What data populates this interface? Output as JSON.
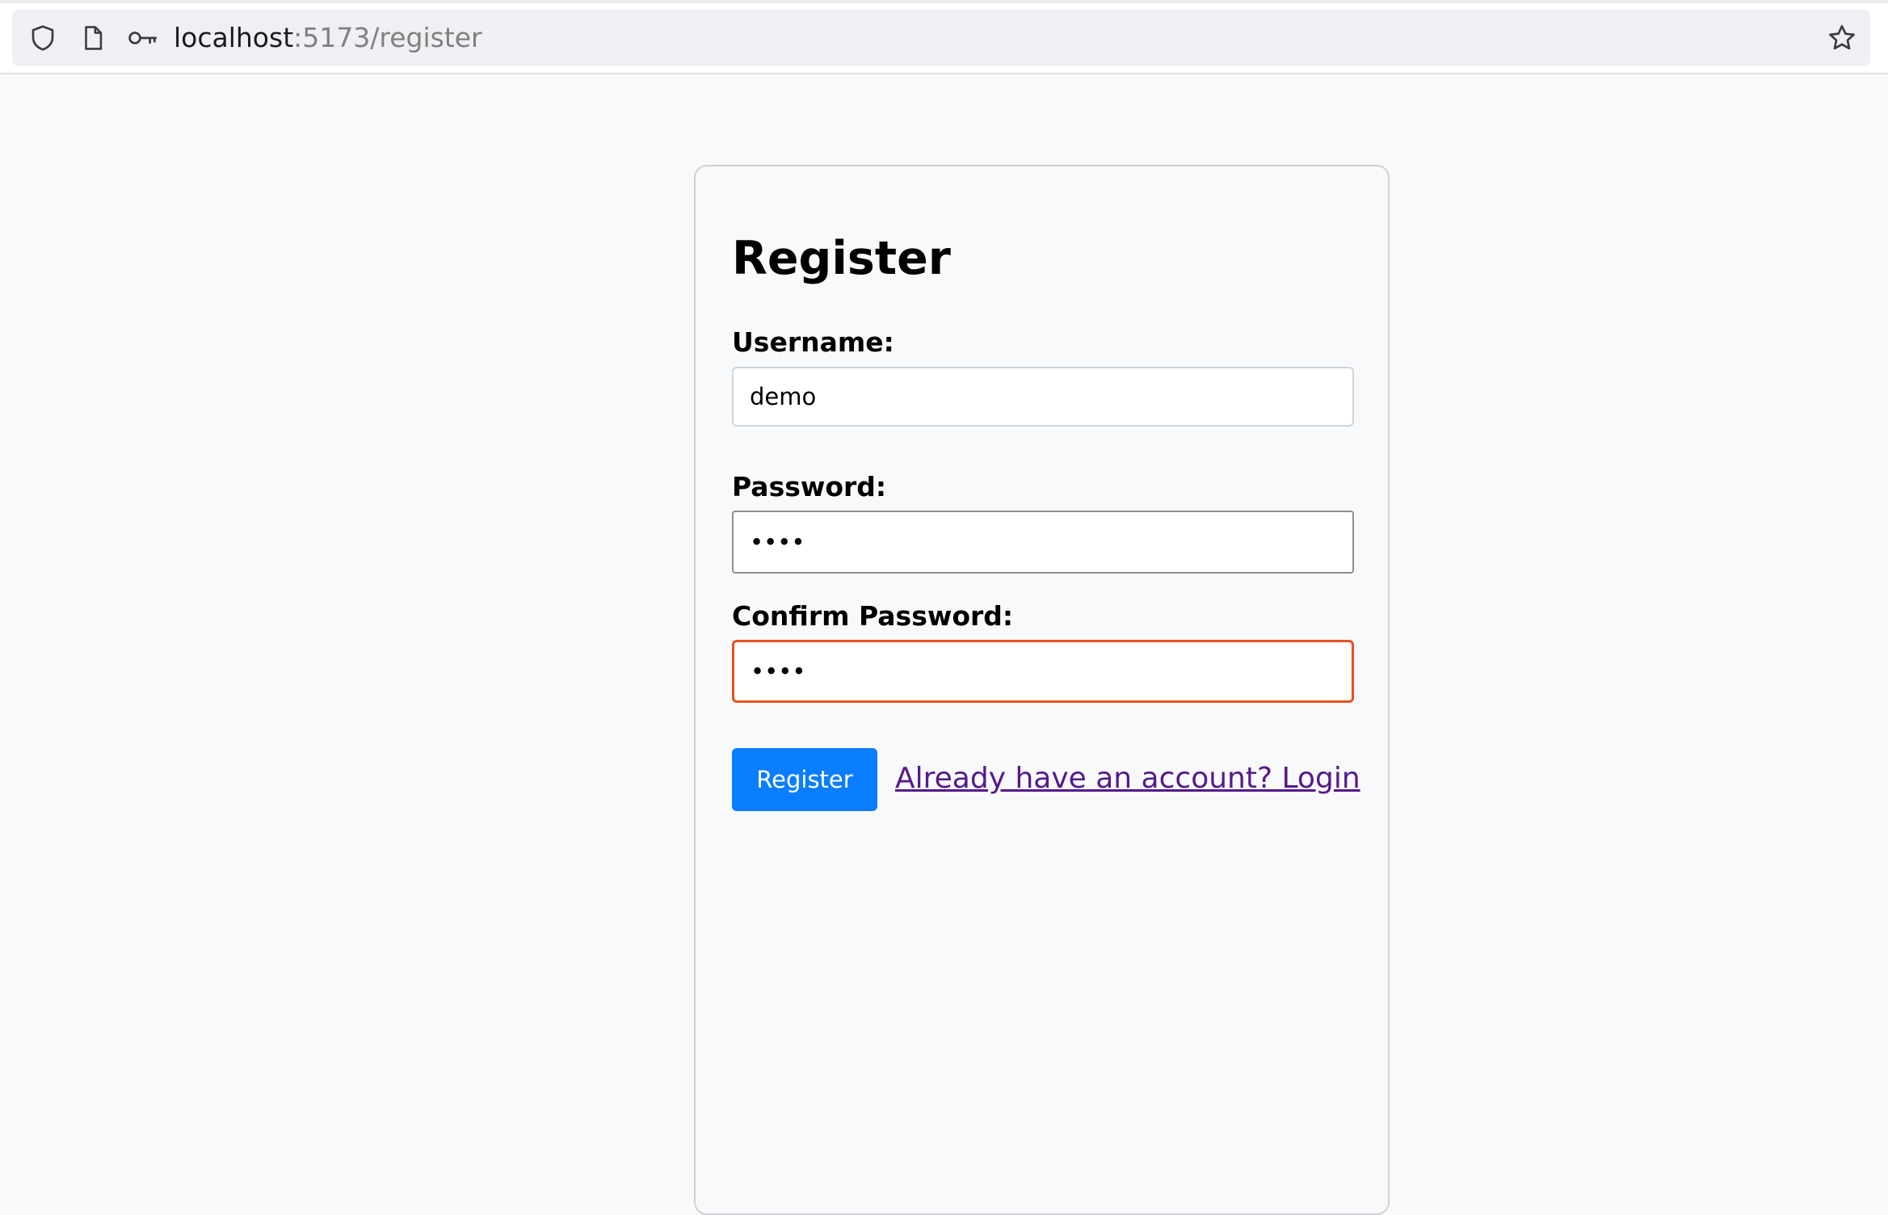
{
  "browser": {
    "url_host": "localhost",
    "url_path": ":5173/register",
    "icons": [
      "shield-icon",
      "page-icon",
      "key-icon",
      "star-icon"
    ]
  },
  "form": {
    "title": "Register",
    "username": {
      "label": "Username:",
      "value": "demo"
    },
    "password": {
      "label": "Password:",
      "value": "demo"
    },
    "confirm_password": {
      "label": "Confirm Password:",
      "value": "demo"
    },
    "submit_label": "Register",
    "login_link": "Already have an account? Login"
  },
  "colors": {
    "page_background": "#f8f9fa",
    "primary_button": "#0b7dff",
    "confirm_field_border": "#e8521f",
    "visited_link": "#551a8b"
  }
}
